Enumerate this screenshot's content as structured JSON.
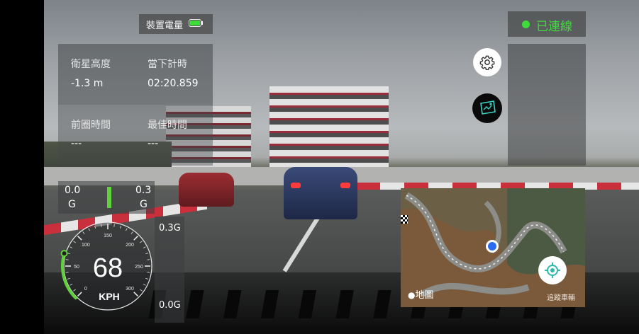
{
  "device_battery": {
    "label": "裝置電量"
  },
  "connection": {
    "label": "已連線",
    "status_color": "#3ddc3a"
  },
  "stats": {
    "altitude": {
      "label": "衛星高度",
      "value": "-1.3 m"
    },
    "current_timer": {
      "label": "當下計時",
      "value": "02:20.859"
    },
    "last_lap": {
      "label": "前圈時間",
      "value": "---"
    },
    "best_lap": {
      "label": "最佳時間",
      "value": "---"
    }
  },
  "g_meter": {
    "left_value": "0.0",
    "left_unit": "G",
    "right_value": "0.3",
    "right_unit": "G",
    "accent": "#5fd13a"
  },
  "g_bar": {
    "top_label": "0.3G",
    "bottom_label": "0.0G"
  },
  "speedometer": {
    "speed": "68",
    "unit": "KPH",
    "ticks": [
      "0",
      "50",
      "100",
      "150",
      "200",
      "250",
      "300"
    ],
    "max": 300,
    "accent": "#5fd13a"
  },
  "map": {
    "attribution": "地圖",
    "locate_label": "追蹤車輛"
  },
  "icons": {
    "settings": "gear-icon",
    "camera_mode": "camera-card-icon",
    "locate": "crosshair-icon",
    "apple": "apple-icon",
    "finish": "checkered-flag-icon"
  }
}
